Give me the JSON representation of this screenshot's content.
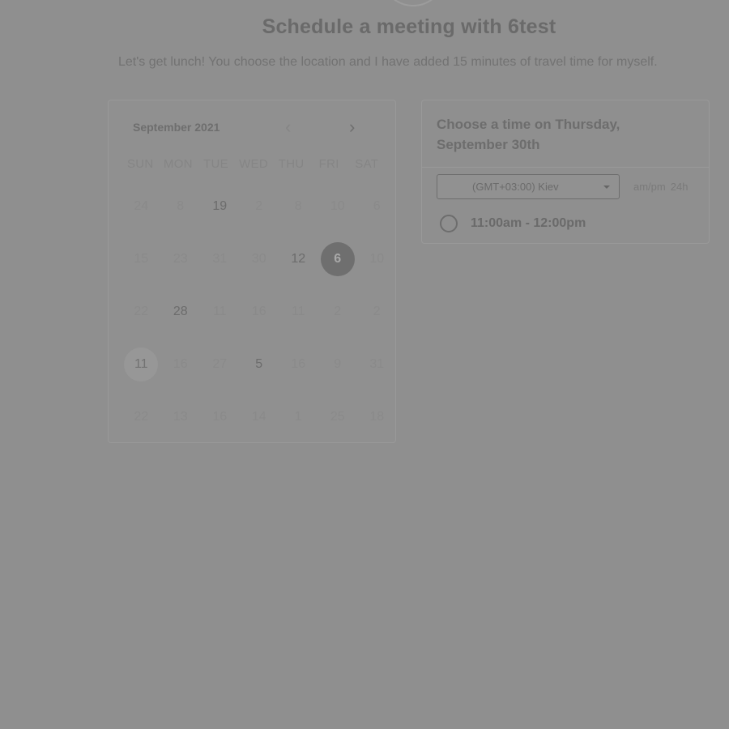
{
  "header": {
    "title": "Schedule a meeting with 6test",
    "description": "Let's get lunch! You choose the location and I have added 15 minutes of travel time for myself."
  },
  "calendar": {
    "month_label": "September 2021",
    "prev_icon": "chevron-left-icon",
    "next_icon": "chevron-right-icon",
    "weekdays": [
      "SUN",
      "MON",
      "TUE",
      "WED",
      "THU",
      "FRI",
      "SAT"
    ],
    "weeks": [
      [
        "24",
        "8",
        "19",
        "2",
        "8",
        "10",
        "6"
      ],
      [
        "15",
        "23",
        "31",
        "30",
        "12",
        "6",
        "10"
      ],
      [
        "22",
        "28",
        "11",
        "16",
        "11",
        "2",
        "2"
      ],
      [
        "11",
        "16",
        "27",
        "5",
        "16",
        "9",
        "31"
      ],
      [
        "22",
        "13",
        "16",
        "14",
        "1",
        "25",
        "18"
      ]
    ],
    "available_days": [
      "19",
      "12",
      "28",
      "5"
    ],
    "selected_day": "6",
    "today_day": "11"
  },
  "time_panel": {
    "heading": "Choose a time on Thursday, September 30th",
    "timezone": "(GMT+03:00) Kiev",
    "format_ampm": "am/pm",
    "format_24h": "24h",
    "slots": [
      "11:00am - 12:00pm"
    ]
  }
}
